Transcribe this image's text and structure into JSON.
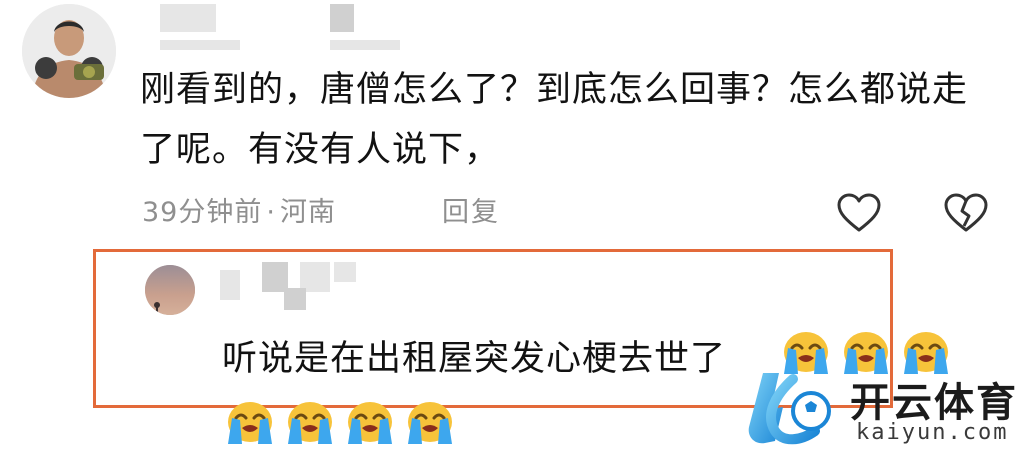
{
  "comment": {
    "avatar_icon": "boxer-avatar-icon",
    "text": "刚看到的，唐僧怎么了？到底怎么回事？怎么都说走了呢。有没有人说下，",
    "time": "39分钟前",
    "separator": "·",
    "location": "河南",
    "reply_label": "回复",
    "like_icon": "heart-outline-icon",
    "dislike_icon": "broken-heart-icon"
  },
  "highlighted_reply": {
    "avatar_icon": "sunset-avatar-icon",
    "text": "听说是在出租屋突发心梗去世了",
    "emoji_name": "loudly-crying-face",
    "emoji_count": 7,
    "border_color": "#e36a3a"
  },
  "watermark": {
    "title": "开云体育",
    "subtitle": "kaiyun.com",
    "brand_color": "#2aa8e8"
  }
}
